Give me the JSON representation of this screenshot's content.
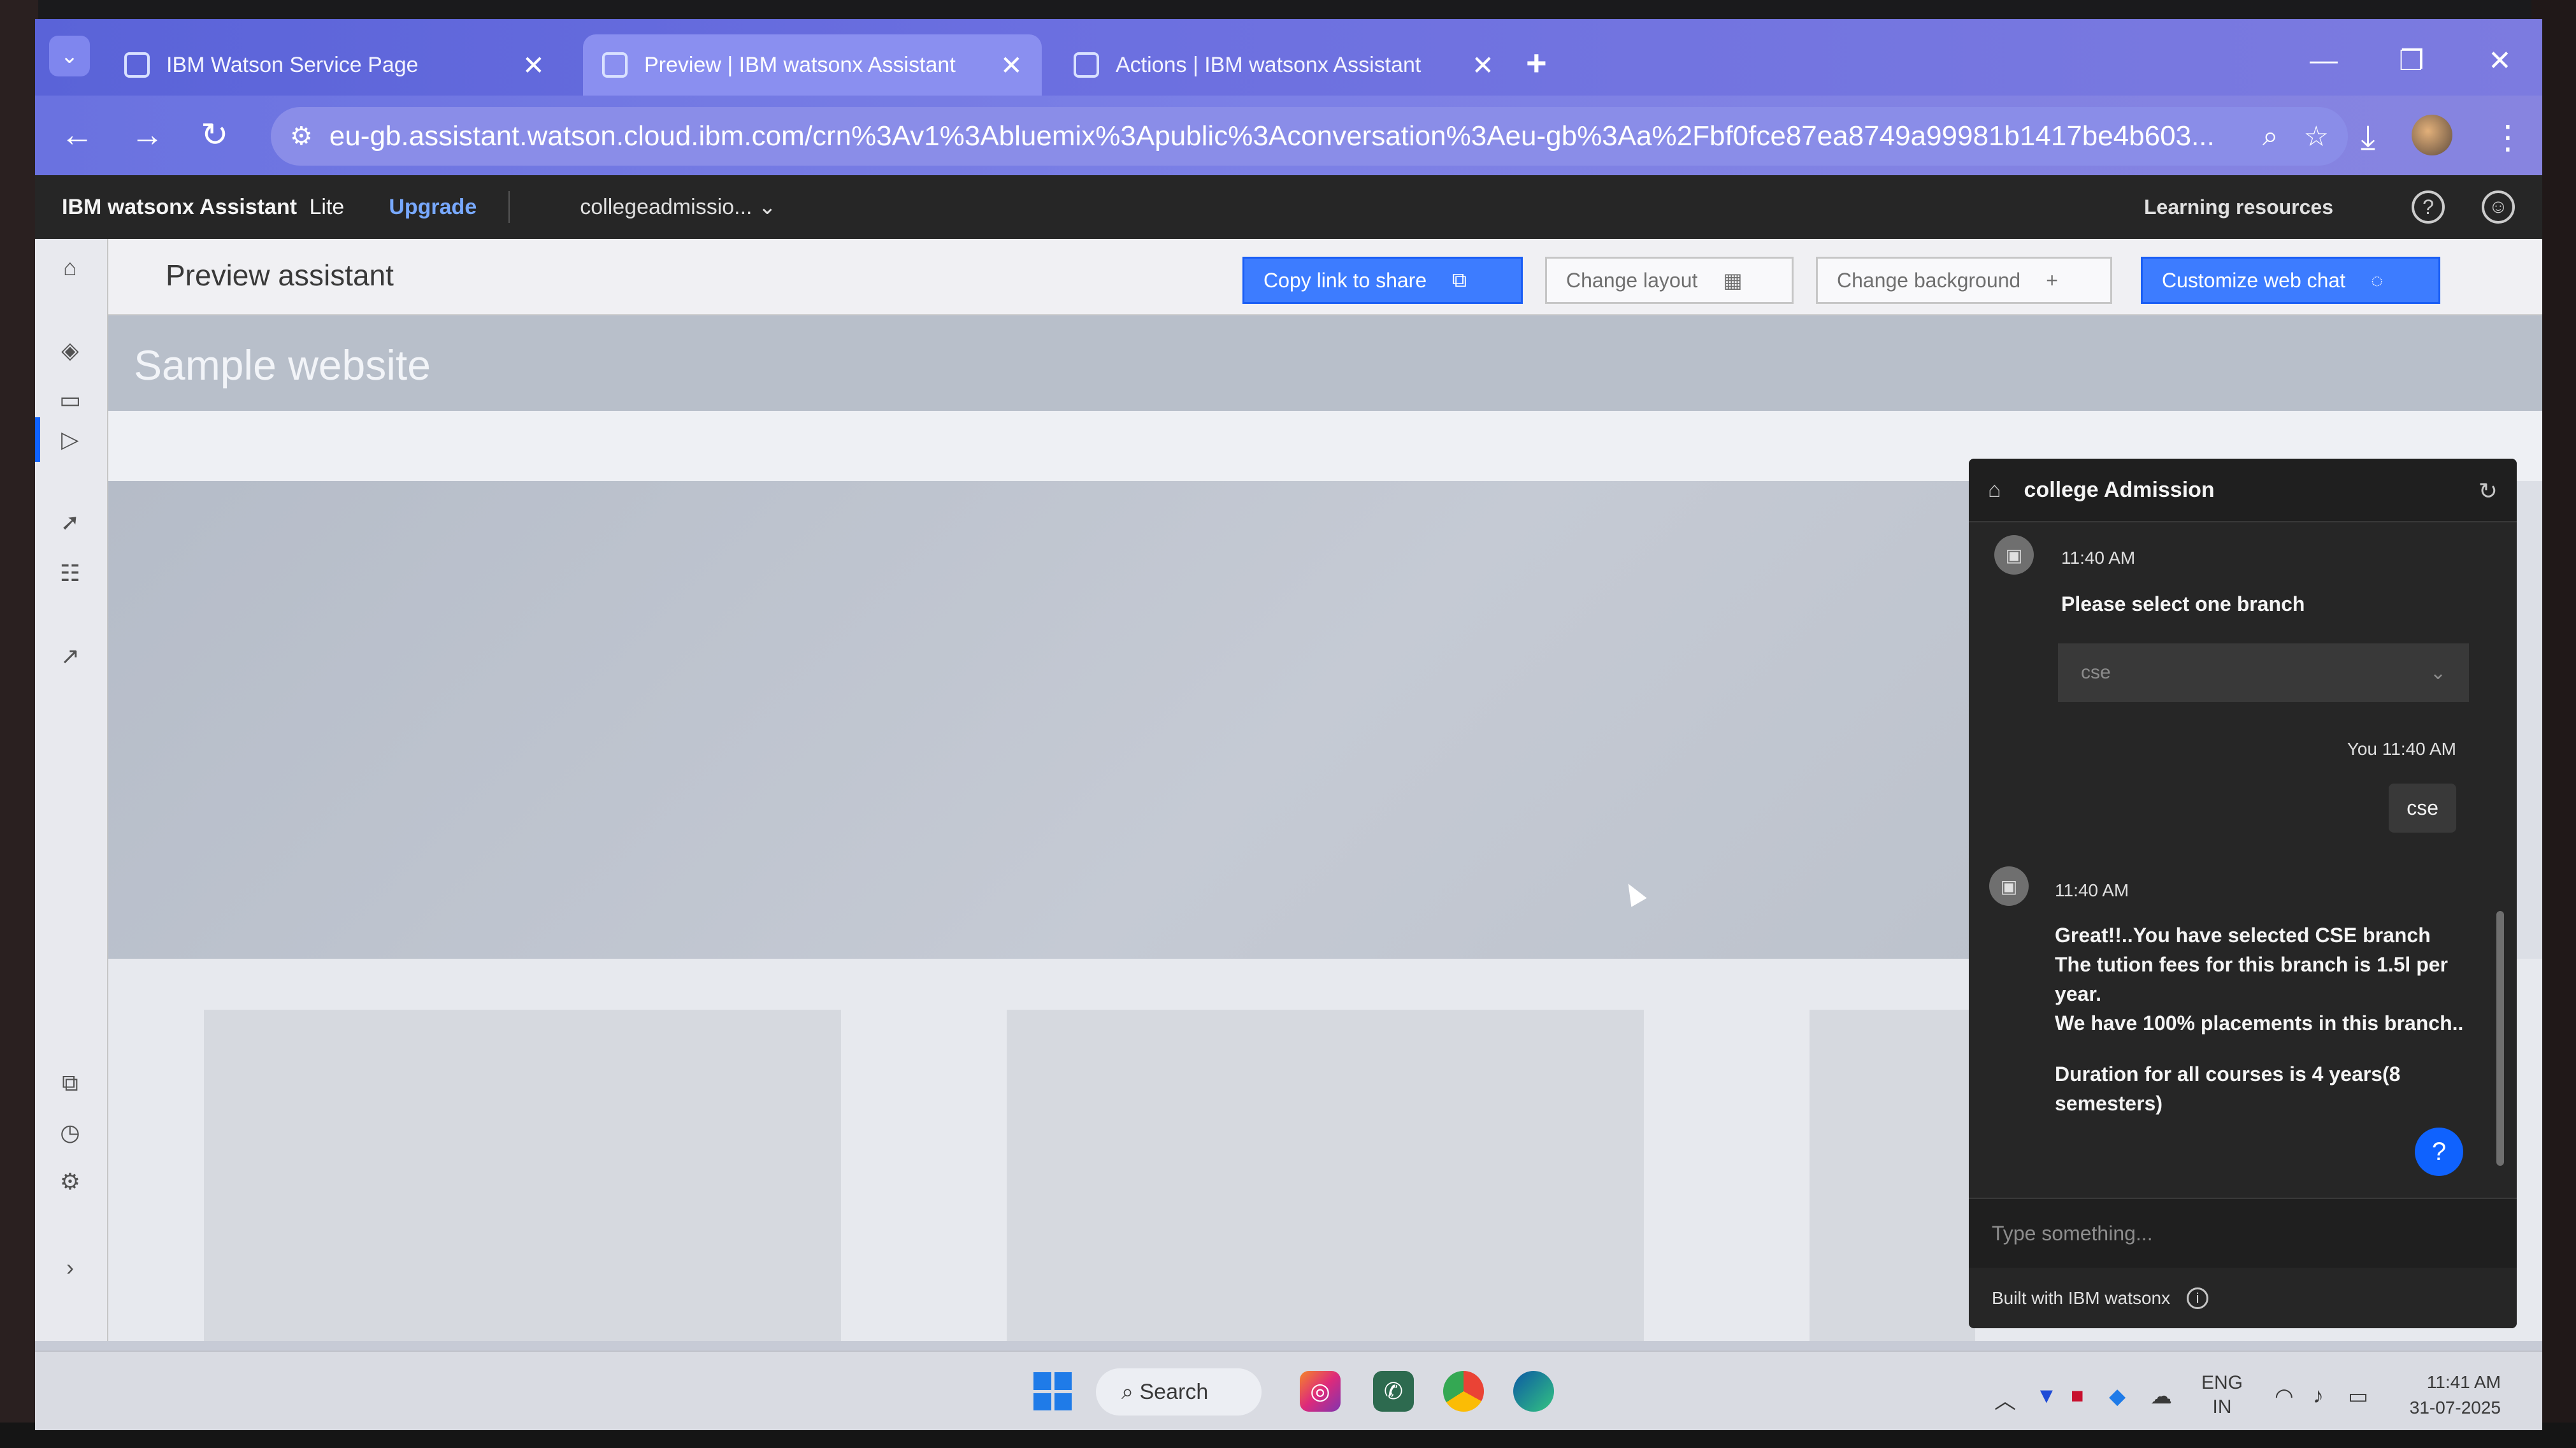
{
  "browser": {
    "tabs": [
      {
        "title": "IBM Watson Service Page",
        "active": false
      },
      {
        "title": "Preview | IBM watsonx Assistant",
        "active": true
      },
      {
        "title": "Actions | IBM watsonx Assistant",
        "active": false
      }
    ],
    "new_tab": "+",
    "url": "eu-gb.assistant.watson.cloud.ibm.com/crn%3Av1%3Abluemix%3Apublic%3Aconversation%3Aeu-gb%3Aa%2Fbf0fce87ea8749a99981b1417be4b603..."
  },
  "header": {
    "brand": "IBM watsonx Assistant",
    "plan": "Lite",
    "upgrade": "Upgrade",
    "assistant_name": "collegeadmissio...",
    "learning_resources": "Learning resources"
  },
  "toolbar": {
    "title": "Preview assistant",
    "copy_link": "Copy link to share",
    "change_layout": "Change layout",
    "change_background": "Change background",
    "customize_web_chat": "Customize web chat"
  },
  "site": {
    "title": "Sample website"
  },
  "chat": {
    "title": "college Admission",
    "messages": [
      {
        "time": "11:40 AM",
        "text": "Please select one branch"
      },
      {
        "time": "11:40 AM",
        "lines": [
          "Great!!..You have selected CSE branch",
          "The tution fees for this branch is 1.5l per",
          "year.",
          "We have 100% placements in this branch..",
          "Duration for all courses is 4 years(8",
          "semesters)"
        ]
      }
    ],
    "select_value": "cse",
    "user_time": "You 11:40 AM",
    "user_reply": "cse",
    "input_placeholder": "Type something...",
    "footer": "Built with IBM watsonx",
    "help": "?"
  },
  "taskbar": {
    "search": "Search",
    "lang_line1": "ENG",
    "lang_line2": "IN",
    "time": "11:41 AM",
    "date": "31-07-2025"
  },
  "colors": {
    "accent": "#0f62fe",
    "header_bg": "#262626",
    "chat_bg": "#262626"
  }
}
